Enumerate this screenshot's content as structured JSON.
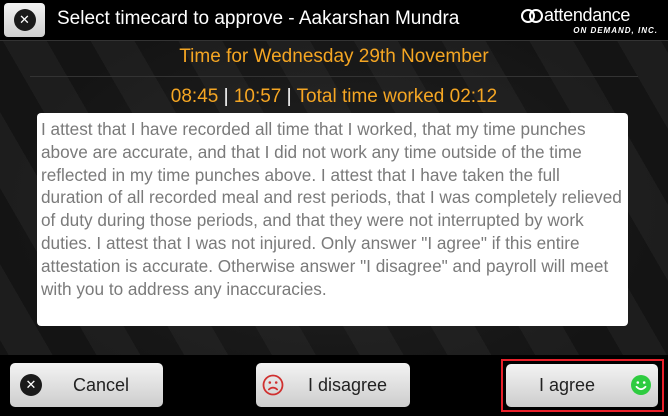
{
  "header": {
    "title": "Select timecard to approve - Aakarshan Mundra",
    "close_icon": "close-x-icon",
    "logo": {
      "main_text": "attendance",
      "sub_text": "ON DEMAND, INC."
    }
  },
  "day_heading": "Time for Wednesday 29th November",
  "punches": {
    "in_time": "08:45",
    "separator": "|",
    "out_time": "10:57",
    "total_label": "Total time worked 02:12"
  },
  "attestation_text": "I attest that I have recorded all time that I worked, that my time punches above are accurate, and that I did not work any time outside of the time reflected in my time punches above. I attest that I have taken the full duration of all recorded meal and rest periods, that I was completely relieved of duty during those periods, and that they were not interrupted by work duties. I attest that I was not injured. Only answer \"I agree\" if this entire attestation is accurate. Otherwise answer \"I disagree\" and payroll will meet with you to address any inaccuracies.",
  "buttons": {
    "cancel": {
      "label": "Cancel",
      "icon": "close-x-icon"
    },
    "disagree": {
      "label": "I disagree",
      "icon": "sad-face-icon"
    },
    "agree": {
      "label": "I agree",
      "icon": "happy-face-icon"
    }
  },
  "colors": {
    "accent_orange": "#f5a623",
    "highlight_red": "#e8202a",
    "sad_red": "#d0302f",
    "happy_green": "#2ecc40"
  }
}
